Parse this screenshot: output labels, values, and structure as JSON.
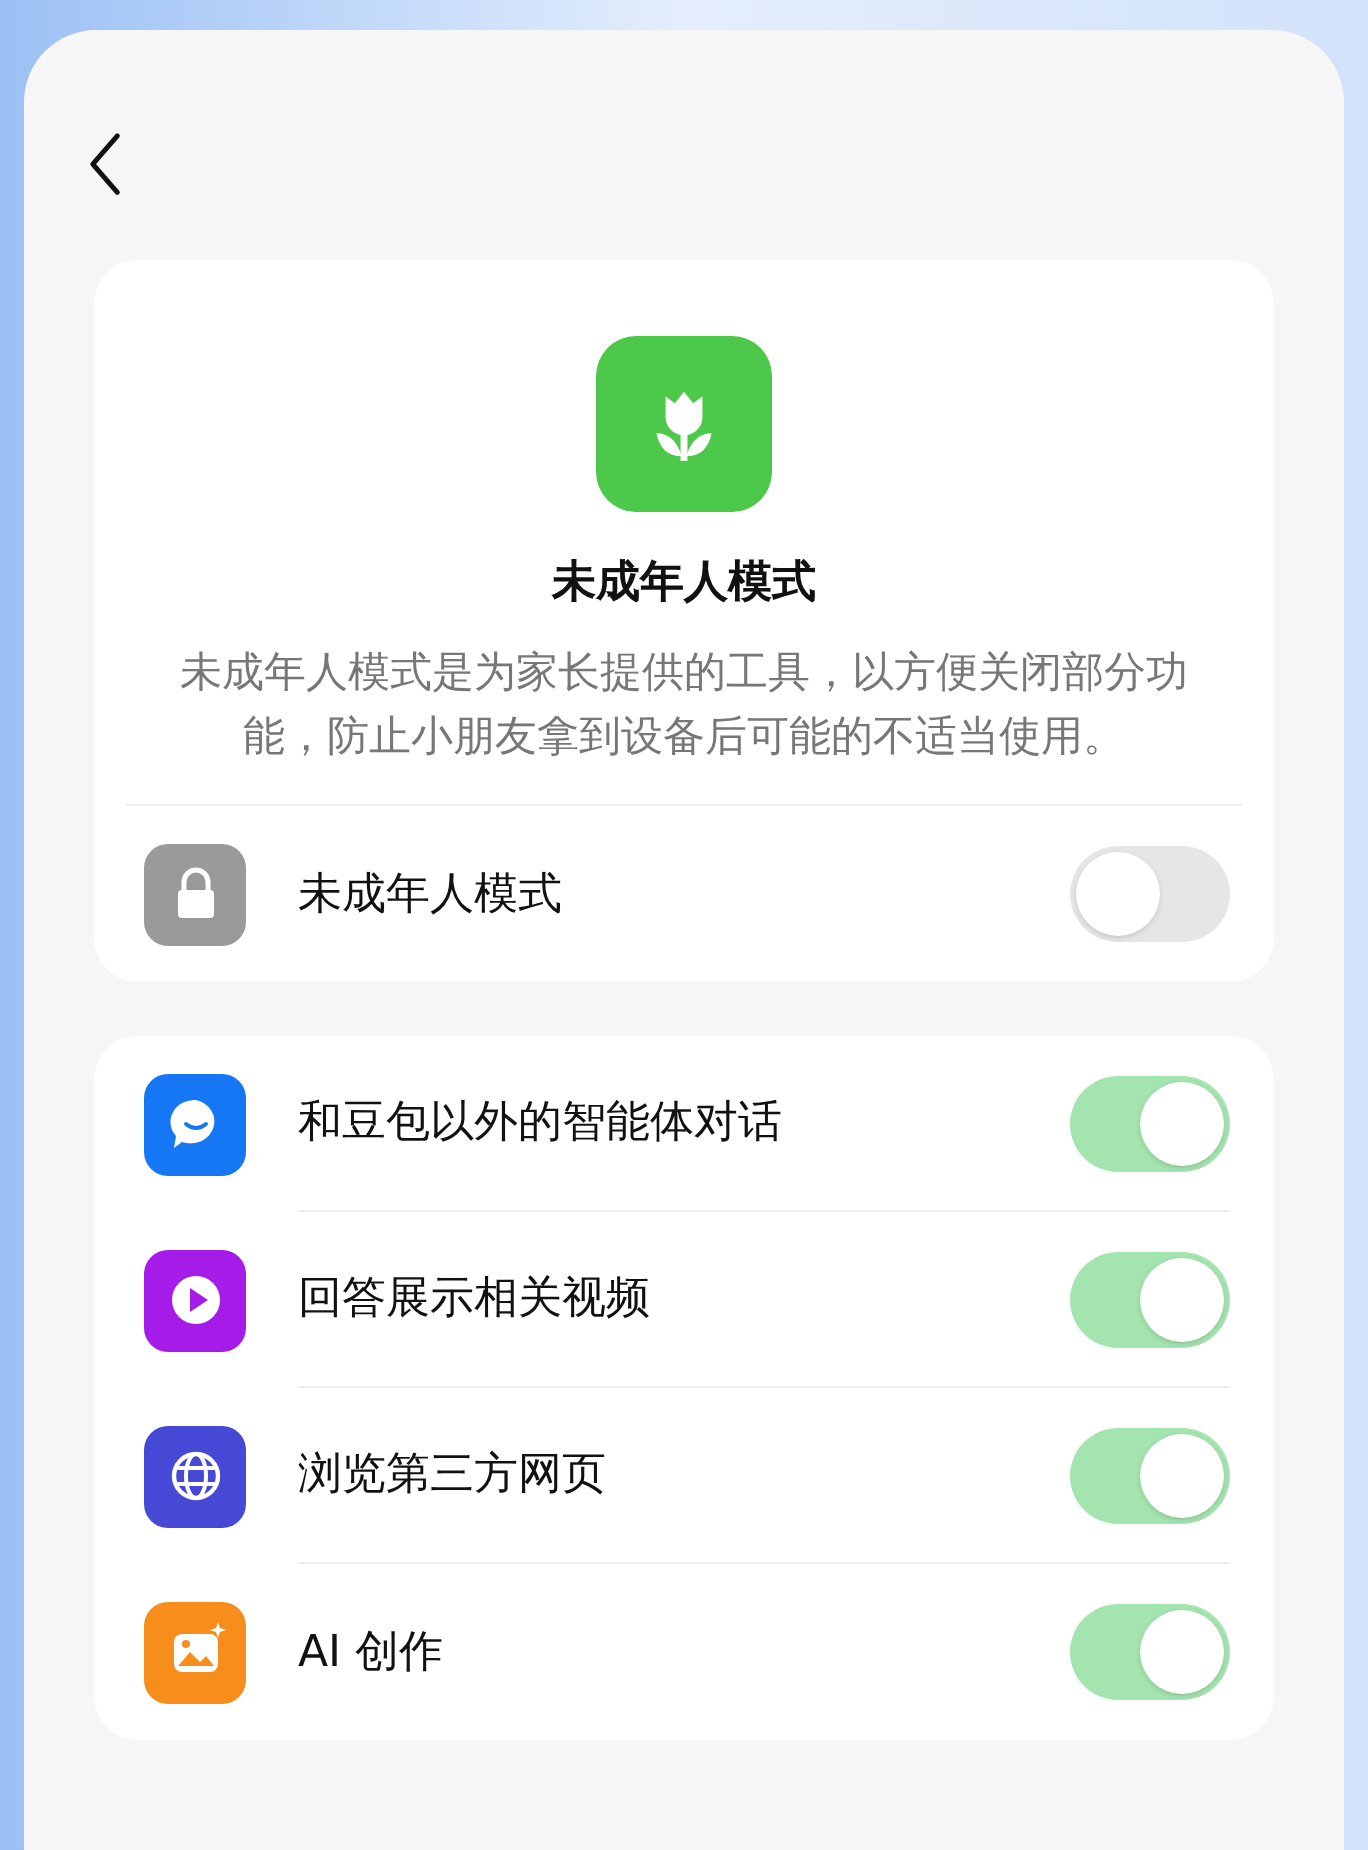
{
  "hero": {
    "title": "未成年人模式",
    "description": "未成年人模式是为家长提供的工具，以方便关闭部分功能，防止小朋友拿到设备后可能的不适当使用。"
  },
  "master": {
    "label": "未成年人模式",
    "kind": "lock",
    "on": false
  },
  "features": [
    {
      "label": "和豆包以外的智能体对话",
      "kind": "chat",
      "on": true
    },
    {
      "label": "回答展示相关视频",
      "kind": "play",
      "on": true
    },
    {
      "label": "浏览第三方网页",
      "kind": "globe",
      "on": true
    },
    {
      "label": "AI 创作",
      "kind": "image",
      "on": true
    }
  ]
}
